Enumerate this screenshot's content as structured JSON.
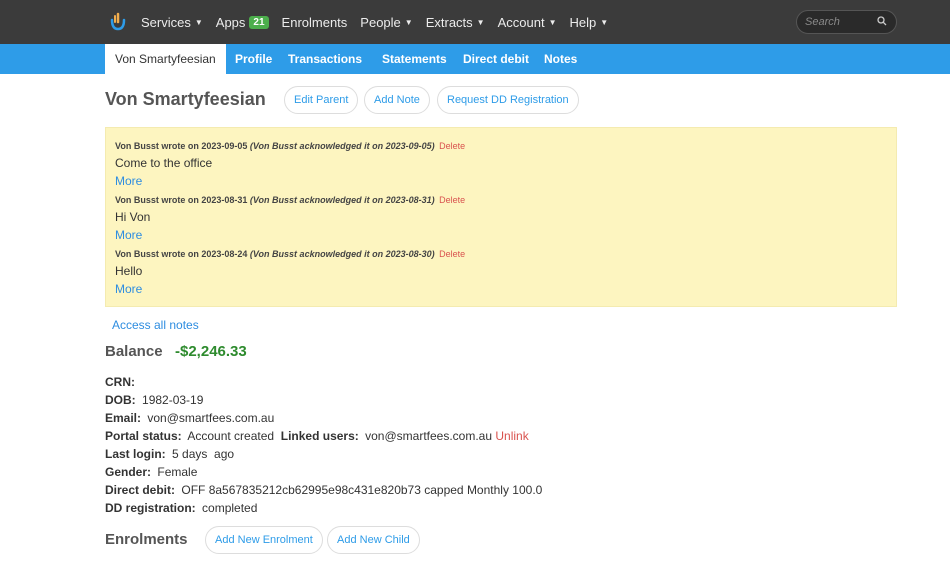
{
  "nav": {
    "items": [
      {
        "label": "Services",
        "caret": true
      },
      {
        "label": "Apps",
        "badge": "21"
      },
      {
        "label": "Enrolments"
      },
      {
        "label": "People",
        "caret": true
      },
      {
        "label": "Extracts",
        "caret": true
      },
      {
        "label": "Account",
        "caret": true
      },
      {
        "label": "Help",
        "caret": true
      }
    ],
    "search_placeholder": "Search"
  },
  "subnav": {
    "active": "Von Smartyfeesian",
    "tabs": [
      "Profile",
      "Transactions",
      "Statements",
      "Direct debit",
      "Notes"
    ]
  },
  "header": {
    "title": "Von Smartyfeesian",
    "buttons": [
      "Edit Parent",
      "Add Note",
      "Request DD Registration"
    ]
  },
  "notes": [
    {
      "meta": "Von Busst wrote on 2023-09-05",
      "ack": "(Von Busst acknowledged it on 2023-09-05)",
      "delete": "Delete",
      "text": "Come to the office",
      "more": "More"
    },
    {
      "meta": "Von Busst wrote on 2023-08-31",
      "ack": "(Von Busst acknowledged it on 2023-08-31)",
      "delete": "Delete",
      "text": "Hi Von",
      "more": "More"
    },
    {
      "meta": "Von Busst wrote on 2023-08-24",
      "ack": "(Von Busst acknowledged it on 2023-08-30)",
      "delete": "Delete",
      "text": "Hello",
      "more": "More"
    }
  ],
  "access_all_notes": "Access all notes",
  "balance": {
    "label": "Balance",
    "value": "-$2,246.33"
  },
  "details": {
    "crn": {
      "label": "CRN:",
      "value": ""
    },
    "dob": {
      "label": "DOB:",
      "value": "1982-03-19"
    },
    "email": {
      "label": "Email:",
      "value": "von@smartfees.com.au"
    },
    "portal_status": {
      "label": "Portal status:",
      "value": "Account created"
    },
    "linked_users": {
      "label": "Linked users:",
      "value": "von@smartfees.com.au",
      "action": "Unlink"
    },
    "last_login": {
      "label": "Last login:",
      "value": "5 days  ago"
    },
    "gender": {
      "label": "Gender:",
      "value": "Female"
    },
    "direct_debit": {
      "label": "Direct debit:",
      "value": "OFF 8a567835212cb62995e98c431e820b73 capped Monthly 100.0"
    },
    "dd_registration": {
      "label": "DD registration:",
      "value": "completed"
    }
  },
  "enrolments": {
    "title": "Enrolments",
    "buttons": [
      "Add New Enrolment",
      "Add New Child"
    ]
  },
  "colors": {
    "topbar": "#3b3b3b",
    "subbar": "#2e9ce8",
    "notes_bg": "#fdf5c0",
    "balance_negative": "#2e8b2e",
    "link": "#2e8de0",
    "danger": "#d9534f"
  },
  "icons": {
    "logo": "hand-logo-icon",
    "search": "search-icon"
  }
}
